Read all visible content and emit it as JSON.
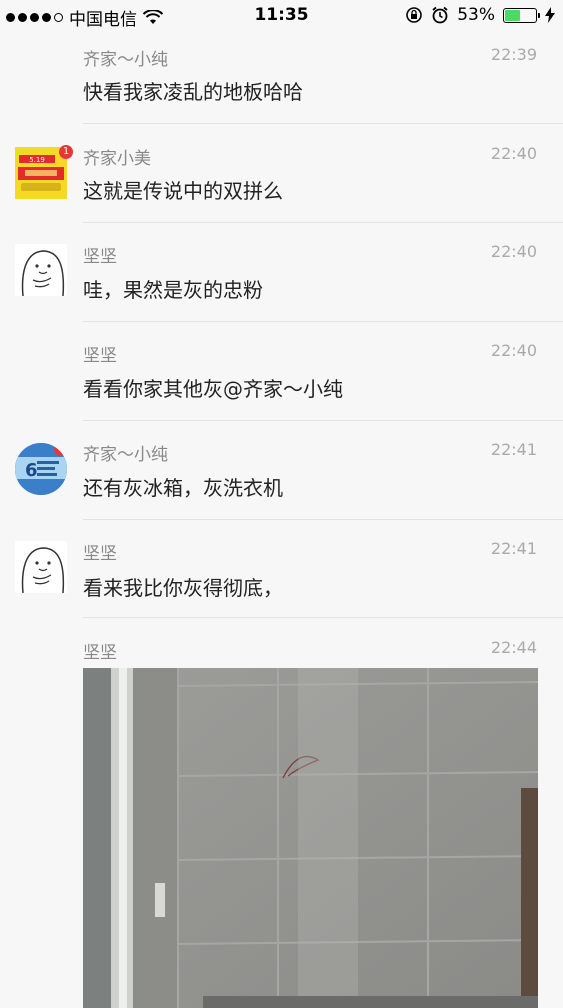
{
  "status_bar": {
    "carrier": "中国电信",
    "time": "11:35",
    "battery": "53%",
    "battery_level": 0.53
  },
  "messages": [
    {
      "name": "齐家～小纯",
      "time": "22:39",
      "text": "快看我家凌乱的地板哈哈"
    },
    {
      "name": "齐家小美",
      "time": "22:40",
      "text": "这就是传说中的双拼么"
    },
    {
      "name": "坚坚",
      "time": "22:40",
      "text": "哇，果然是灰的忠粉"
    },
    {
      "name": "坚坚",
      "time": "22:40",
      "text": "看看你家其他灰@齐家～小纯"
    },
    {
      "name": "齐家～小纯",
      "time": "22:41",
      "text": "还有灰冰箱，灰洗衣机"
    },
    {
      "name": "坚坚",
      "time": "22:41",
      "text": "看来我比你灰得彻底，"
    },
    {
      "name": "坚坚",
      "time": "22:44"
    }
  ],
  "avatars": {
    "promo_badge": "1",
    "promo_top": "5.19"
  }
}
